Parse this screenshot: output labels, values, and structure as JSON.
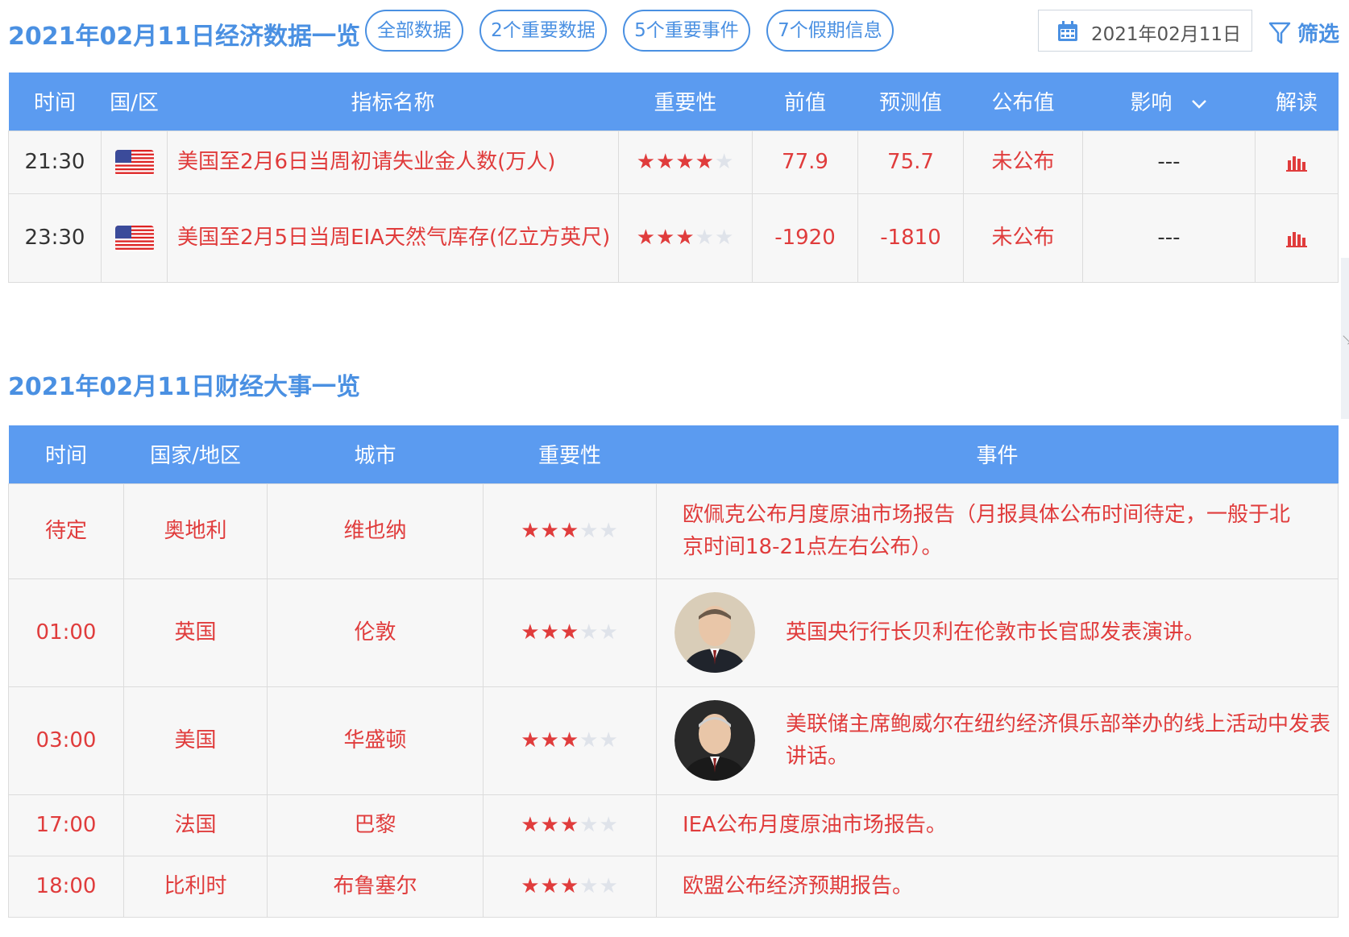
{
  "header": {
    "title": "2021年02月11日经济数据一览",
    "filters": [
      {
        "label": "全部数据"
      },
      {
        "label": "2个重要数据"
      },
      {
        "label": "5个重要事件"
      },
      {
        "label": "7个假期信息"
      }
    ],
    "date": "2021年02月11日",
    "filter_label": "筛选"
  },
  "data_table": {
    "columns": [
      "时间",
      "国/区",
      "指标名称",
      "重要性",
      "前值",
      "预测值",
      "公布值",
      "影响",
      "解读"
    ],
    "rows": [
      {
        "time": "21:30",
        "flag": "us-flag-icon",
        "name": "美国至2月6日当周初请失业金人数(万人)",
        "stars": 4,
        "prev": "77.9",
        "forecast": "75.7",
        "actual": "未公布",
        "impact": "---"
      },
      {
        "time": "23:30",
        "flag": "us-flag-icon",
        "name": "美国至2月5日当周EIA天然气库存(亿立方英尺)",
        "stars": 3,
        "prev": "-1920",
        "forecast": "-1810",
        "actual": "未公布",
        "impact": "---"
      }
    ]
  },
  "events": {
    "title": "2021年02月11日财经大事一览",
    "columns": [
      "时间",
      "国家/地区",
      "城市",
      "重要性",
      "事件"
    ],
    "rows": [
      {
        "time": "待定",
        "country": "奥地利",
        "city": "维也纳",
        "stars": 3,
        "event": "欧佩克公布月度原油市场报告（月报具体公布时间待定，一般于北京时间18-21点左右公布）。",
        "avatar": ""
      },
      {
        "time": "01:00",
        "country": "英国",
        "city": "伦敦",
        "stars": 3,
        "event": "英国央行行长贝利在伦敦市长官邸发表演讲。",
        "avatar": "speaker-portrait"
      },
      {
        "time": "03:00",
        "country": "美国",
        "city": "华盛顿",
        "stars": 3,
        "event": "美联储主席鲍威尔在纽约经济俱乐部举办的线上活动中发表讲话。",
        "avatar": "speaker-portrait"
      },
      {
        "time": "17:00",
        "country": "法国",
        "city": "巴黎",
        "stars": 3,
        "event": "IEA公布月度原油市场报告。",
        "avatar": ""
      },
      {
        "time": "18:00",
        "country": "比利时",
        "city": "布鲁塞尔",
        "stars": 3,
        "event": "欧盟公布经济预期报告。",
        "avatar": ""
      }
    ]
  },
  "colors": {
    "accent": "#4a90e2",
    "header_bg": "#5b9bf0",
    "red": "#e03c3c"
  }
}
